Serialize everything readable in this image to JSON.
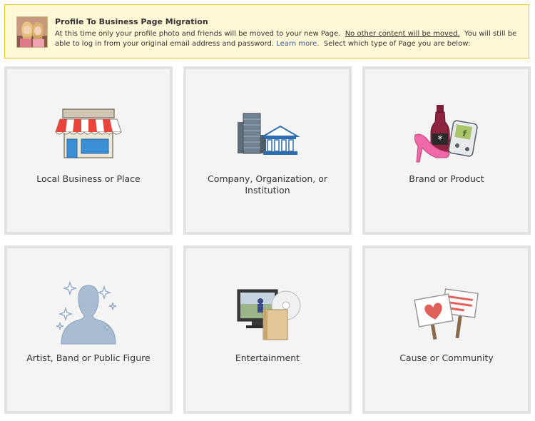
{
  "notice": {
    "title": "Profile To Business Page Migration",
    "text_1": "At this time only your profile photo and friends will be moved to your new Page.",
    "text_2": "No other content will be moved.",
    "text_3": "You will still be able to log in from your original email address and password.",
    "link": "Learn more.",
    "text_4": "Select which type of Page you are below:"
  },
  "categories": [
    {
      "label": "Local Business or Place",
      "icon": "storefront-icon"
    },
    {
      "label": "Company, Organization, or Institution",
      "icon": "buildings-icon"
    },
    {
      "label": "Brand or Product",
      "icon": "products-icon"
    },
    {
      "label": "Artist, Band or Public Figure",
      "icon": "person-silhouette-icon"
    },
    {
      "label": "Entertainment",
      "icon": "media-icon"
    },
    {
      "label": "Cause or Community",
      "icon": "signs-icon"
    }
  ],
  "colors": {
    "notice_bg": "#fff9d7",
    "notice_border": "#e2c822",
    "link": "#3b5998",
    "cell_bg": "#f4f4f4",
    "cell_border": "#e2e2e2"
  }
}
